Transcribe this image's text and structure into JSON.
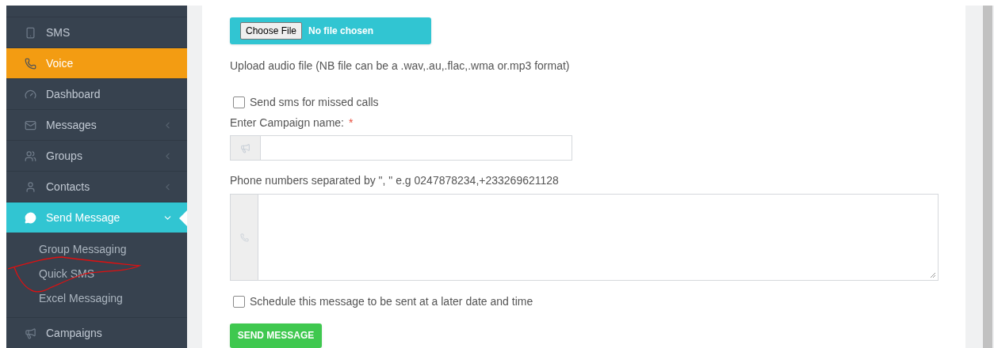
{
  "sidebar": {
    "items": [
      {
        "label": "SMS",
        "highlighted": false,
        "has_submenu": false,
        "expanded": false
      },
      {
        "label": "Voice",
        "highlighted": true,
        "color": "#f39c12",
        "has_submenu": false,
        "expanded": false
      },
      {
        "label": "Dashboard",
        "highlighted": false,
        "has_submenu": false,
        "expanded": false
      },
      {
        "label": "Messages",
        "highlighted": false,
        "has_submenu": true,
        "expanded": false
      },
      {
        "label": "Groups",
        "highlighted": false,
        "has_submenu": true,
        "expanded": false
      },
      {
        "label": "Contacts",
        "highlighted": false,
        "has_submenu": true,
        "expanded": false
      },
      {
        "label": "Send Message",
        "highlighted": true,
        "color": "#31c5d2",
        "has_submenu": true,
        "expanded": true,
        "children": [
          {
            "label": "Group Messaging"
          },
          {
            "label": "Quick SMS"
          },
          {
            "label": "Excel Messaging"
          }
        ]
      },
      {
        "label": "Campaigns",
        "highlighted": false,
        "has_submenu": false,
        "expanded": false
      }
    ]
  },
  "form": {
    "file_input": {
      "button": "Choose File",
      "status": "No file chosen"
    },
    "upload_help": "Upload audio file (NB file can be a .wav,.au,.flac,.wma or.mp3 format)",
    "missed_calls_checkbox": {
      "label": "Send sms for missed calls",
      "checked": false
    },
    "campaign_name": {
      "label": "Enter Campaign name:",
      "required_mark": "*"
    },
    "phone_numbers": {
      "label": "Phone numbers separated by \", \" e.g 0247878234,+233269621128"
    },
    "schedule_checkbox": {
      "label": "Schedule this message to be sent at a later date and time",
      "checked": false
    },
    "submit_button": "SEND MESSAGE"
  }
}
